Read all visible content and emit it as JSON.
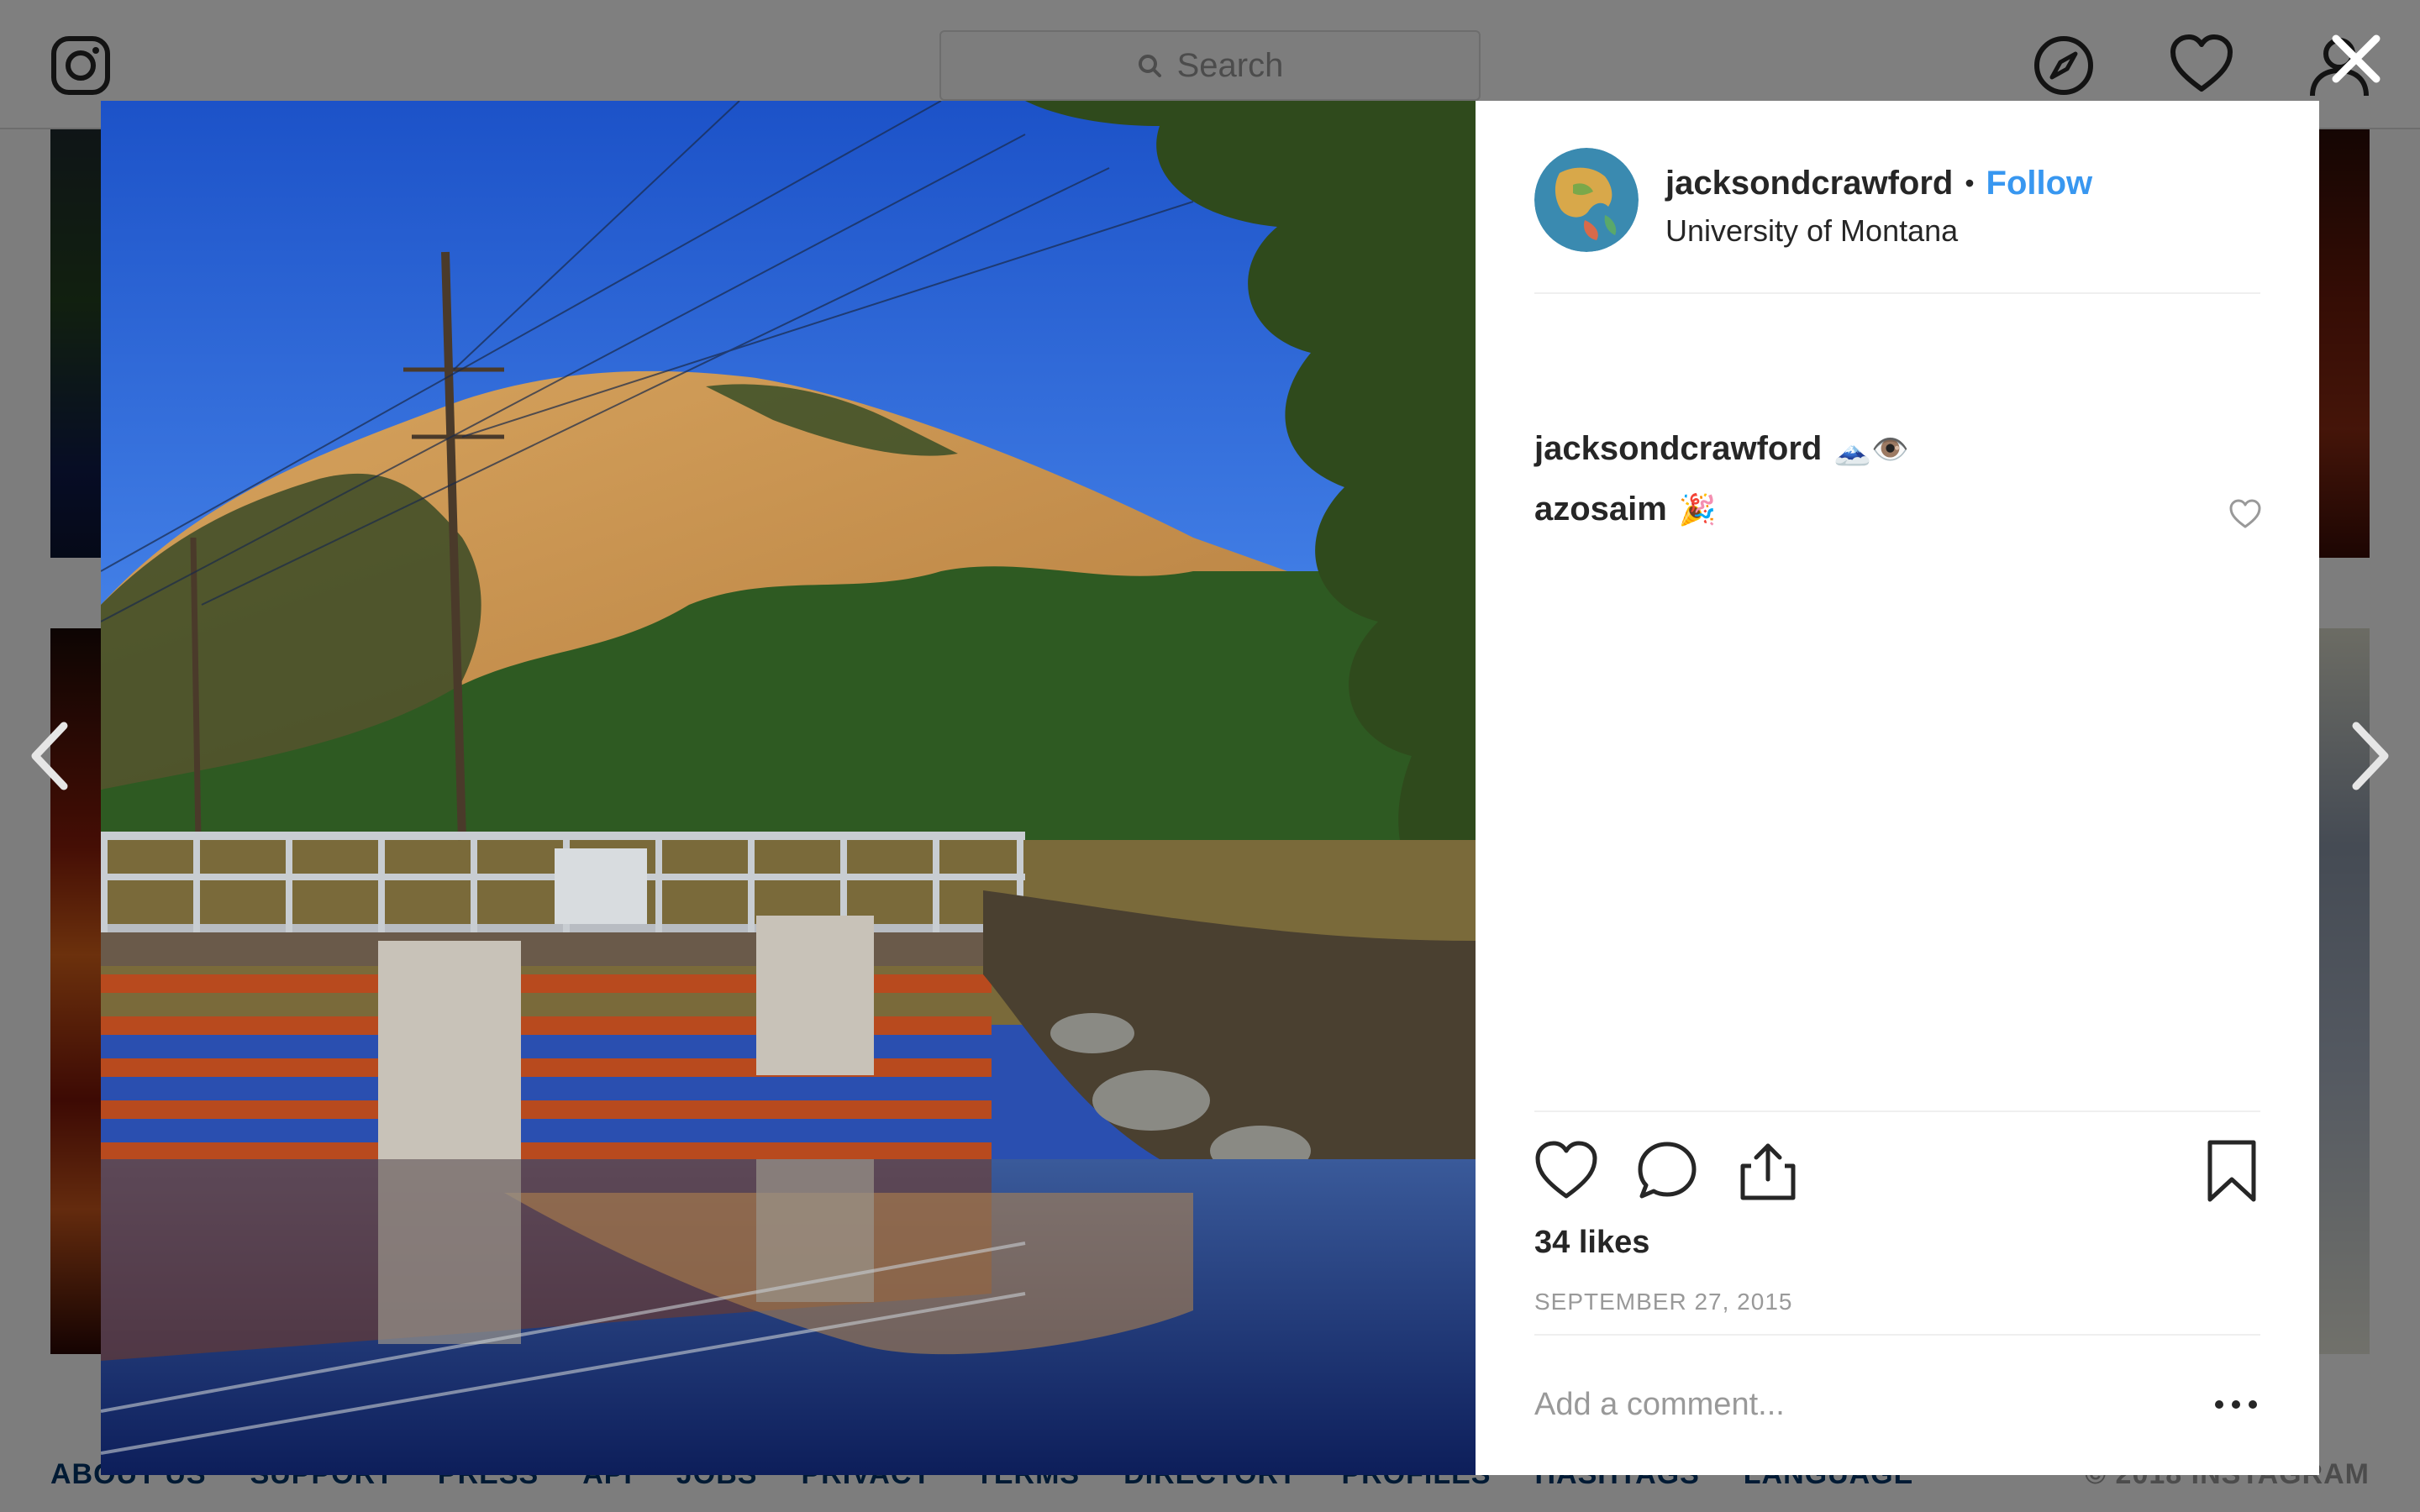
{
  "nav": {
    "search_placeholder": "Search",
    "icons": [
      "instagram-logo-icon",
      "compass-icon",
      "heart-icon",
      "user-icon"
    ]
  },
  "footer": {
    "links": [
      "ABOUT US",
      "SUPPORT",
      "PRESS",
      "API",
      "JOBS",
      "PRIVACY",
      "TERMS",
      "DIRECTORY",
      "PROFILES",
      "HASHTAGS",
      "LANGUAGE"
    ],
    "copyright": "© 2018 INSTAGRAM"
  },
  "post": {
    "username": "jacksondcrawford",
    "separator": "•",
    "follow_label": "Follow",
    "location": "University of Montana",
    "comments": [
      {
        "user": "jacksondcrawford",
        "text": "🗻👁️"
      },
      {
        "user": "azosaim",
        "text": "🎉"
      }
    ],
    "likes": "34 likes",
    "date": "SEPTEMBER 27, 2015",
    "comment_placeholder": "Add a comment..."
  },
  "colors": {
    "follow": "#3897f0",
    "footer_link": "#003569",
    "sky": "#2a5fd0",
    "hill": "#c98e4a"
  }
}
